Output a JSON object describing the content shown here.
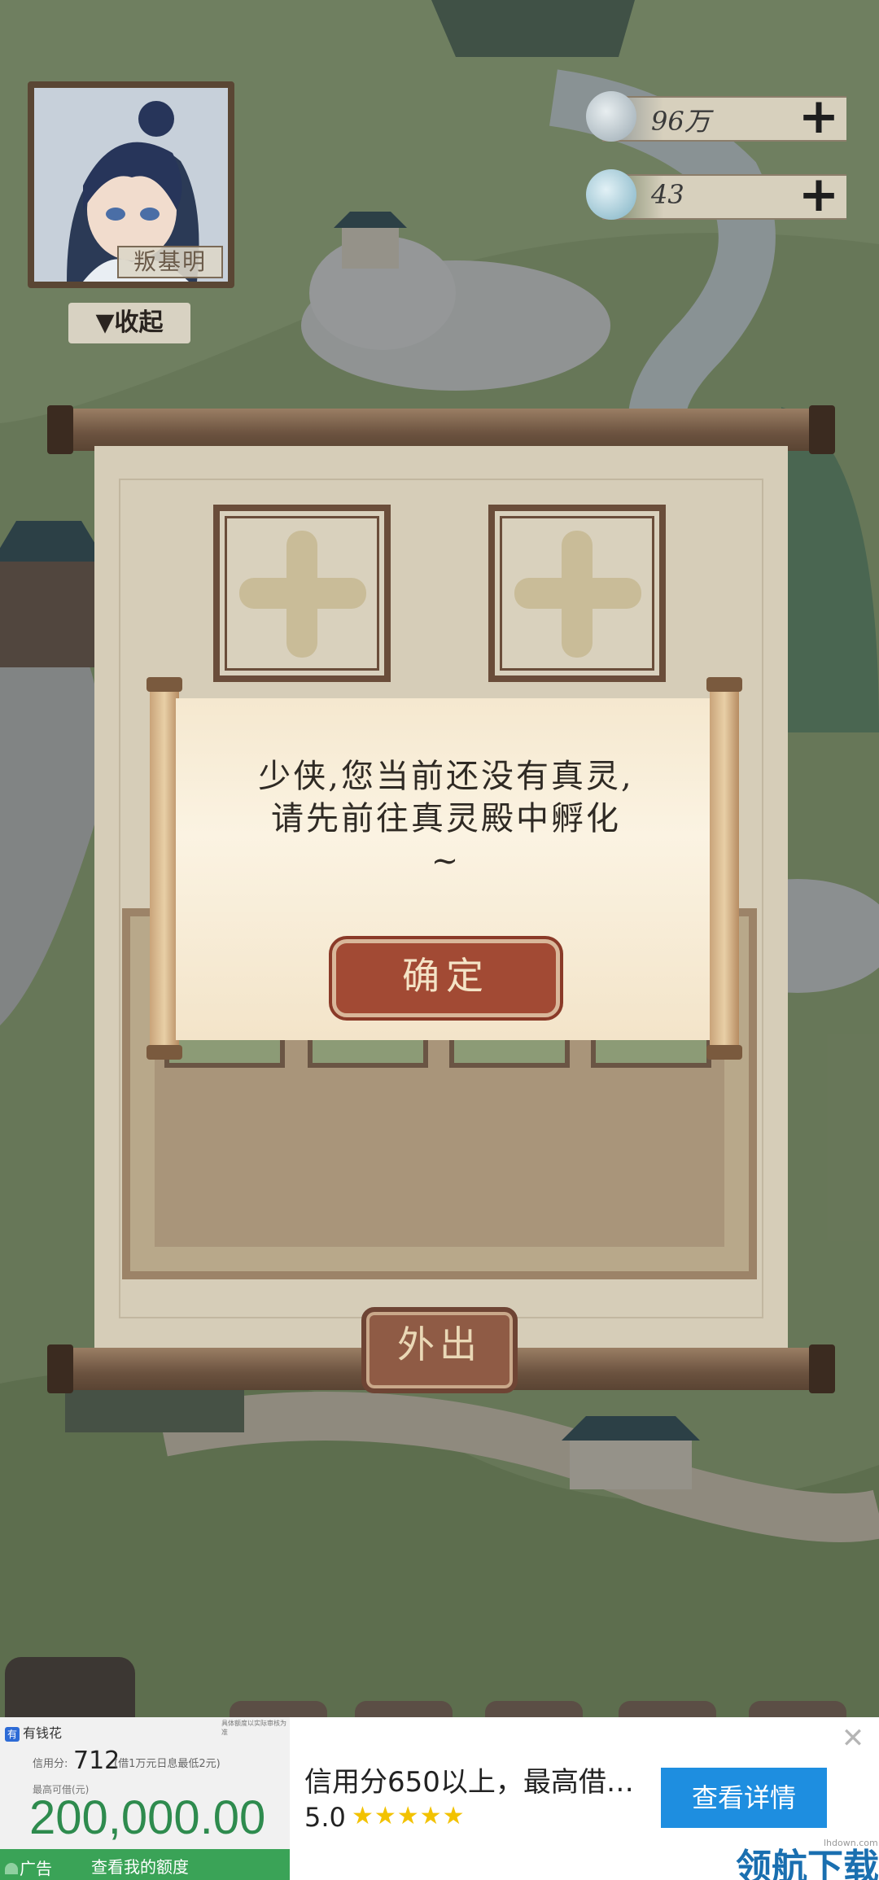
{
  "player": {
    "name": "叛基明",
    "collapse_label": "▼收起"
  },
  "resources": [
    {
      "icon": "cloud-coin-icon",
      "value": "96万",
      "plus": "+"
    },
    {
      "icon": "spirit-icon",
      "value": "43",
      "plus": "+"
    }
  ],
  "dialog": {
    "message": "少侠,您当前还没有真灵,请先前往真灵殿中孵化~",
    "confirm_label": "确定"
  },
  "panel": {
    "out_label": "外出"
  },
  "ad": {
    "app_name": "有钱花",
    "tiny_note": "具体额度以实际审核为准",
    "score_label": "信用分:",
    "score": "712",
    "score_note": "(借1万元日息最低2元)",
    "max_label": "最高可借(元)",
    "amount": "200,000.00",
    "tag": "广告",
    "check_label": "查看我的额度",
    "title": "信用分650以上，最高借…",
    "rating": "5.0",
    "stars": "★★★★★",
    "cta": "查看详情",
    "close": "✕"
  },
  "watermark": {
    "text": "领航下载",
    "small": "lhdown.com"
  },
  "colors": {
    "scroll_rod": "#6b523f",
    "confirm_button": "#a24a34",
    "ad_green": "#3aa357",
    "ad_cta": "#1e8ee0"
  }
}
